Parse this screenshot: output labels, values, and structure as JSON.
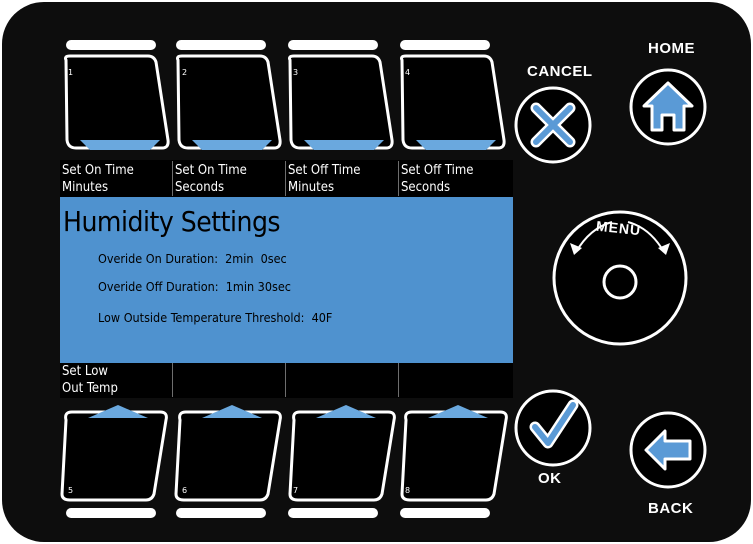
{
  "screen": {
    "title": "Humidity Settings",
    "lines": [
      "Overide On Duration:  2min  0sec",
      "Overide Off Duration:  1min 30sec",
      "Low Outside Temperature Threshold:  40F"
    ]
  },
  "softkeys_top": [
    {
      "number": "1",
      "line1": "Set On Time",
      "line2": "Minutes"
    },
    {
      "number": "2",
      "line1": "Set On Time",
      "line2": "Seconds"
    },
    {
      "number": "3",
      "line1": "Set Off Time",
      "line2": "Minutes"
    },
    {
      "number": "4",
      "line1": "Set Off Time",
      "line2": "Seconds"
    }
  ],
  "softkeys_bottom": [
    {
      "number": "5",
      "line1": "Set Low",
      "line2": "Out Temp"
    },
    {
      "number": "6",
      "line1": "",
      "line2": ""
    },
    {
      "number": "7",
      "line1": "",
      "line2": ""
    },
    {
      "number": "8",
      "line1": "",
      "line2": ""
    }
  ],
  "buttons": {
    "cancel": "CANCEL",
    "home": "HOME",
    "menu": "MENU",
    "ok": "OK",
    "back": "BACK"
  },
  "colors": {
    "panel": "#0d0d0d",
    "screen": "#4f92cf",
    "accent": "#7fb6e6"
  }
}
